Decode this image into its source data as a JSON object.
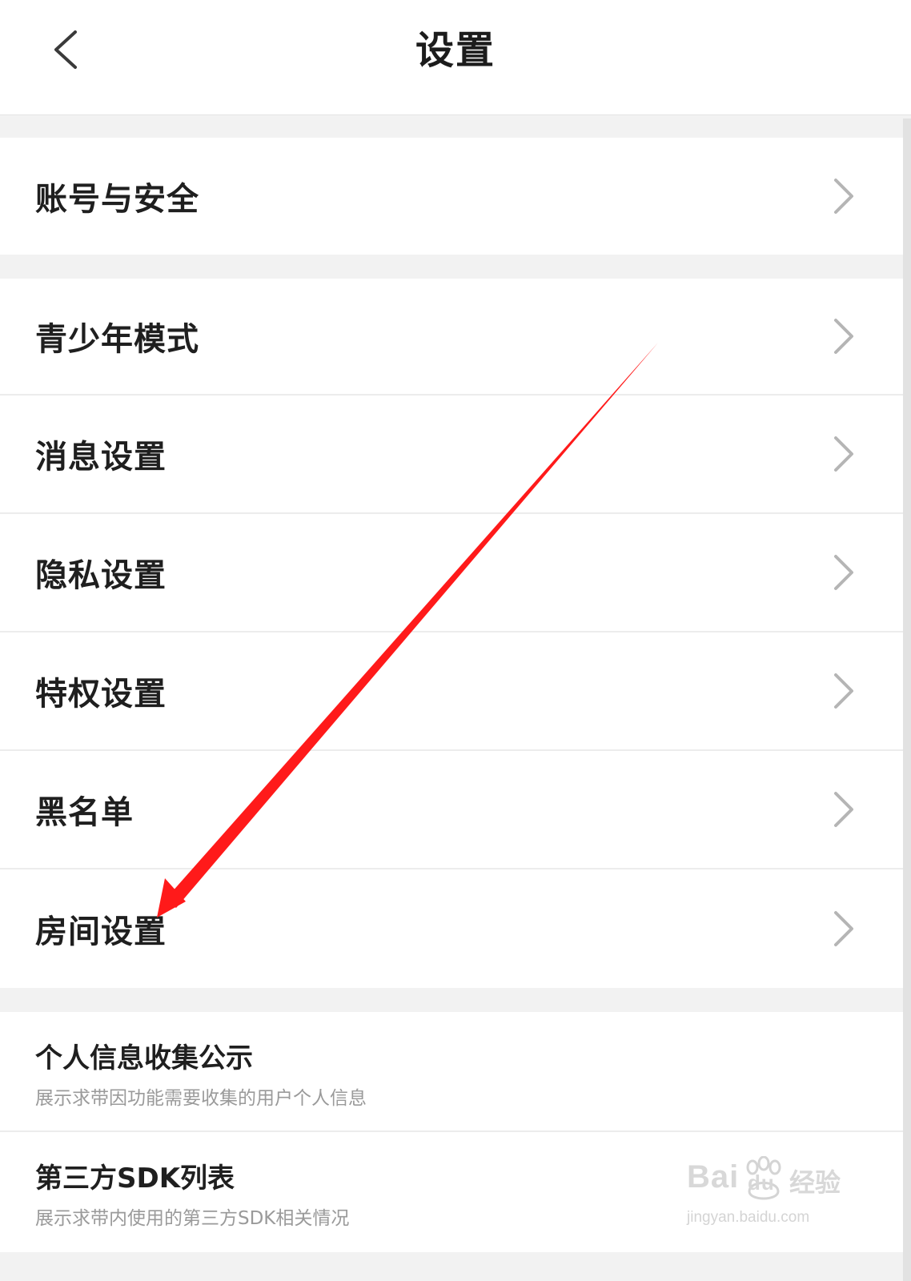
{
  "header": {
    "title": "设置",
    "back_icon": "chevron-left-icon"
  },
  "groups": [
    {
      "items": [
        {
          "label": "账号与安全"
        }
      ]
    },
    {
      "items": [
        {
          "label": "青少年模式"
        },
        {
          "label": "消息设置"
        },
        {
          "label": "隐私设置"
        },
        {
          "label": "特权设置"
        },
        {
          "label": "黑名单"
        },
        {
          "label": "房间设置"
        }
      ]
    },
    {
      "items": [
        {
          "label": "个人信息收集公示",
          "sub": "展示求带因功能需要收集的用户个人信息"
        },
        {
          "label": "第三方SDK列表",
          "sub": "展示求带内使用的第三方SDK相关情况"
        }
      ]
    }
  ],
  "annotation": {
    "arrow_color": "#ff1a1a"
  },
  "watermark": {
    "logo_text_left": "Bai",
    "logo_text_right": "du",
    "brand": "经验",
    "url": "jingyan.baidu.com"
  },
  "colors": {
    "background": "#f2f2f2",
    "surface": "#ffffff",
    "divider": "#ececec",
    "text_primary": "#1f1f1f",
    "text_secondary": "#9a9a9a",
    "chevron": "#b5b5b5"
  }
}
